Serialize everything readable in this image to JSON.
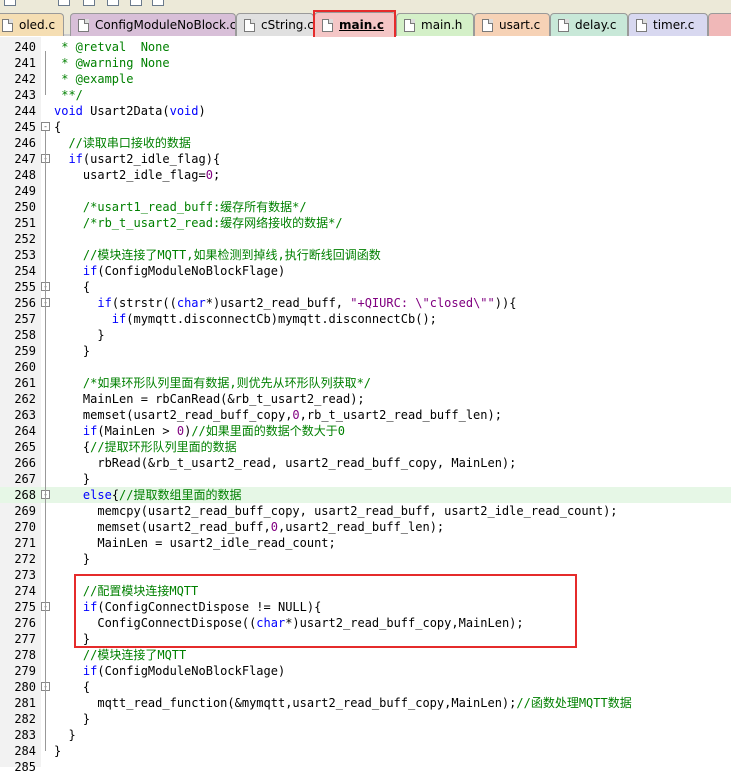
{
  "tabs": [
    {
      "label": "oled.c",
      "color": "#f5deb3",
      "active": false
    },
    {
      "label": "ConfigModuleNoBlock.c",
      "color": "#d8bfd8",
      "active": false
    },
    {
      "label": "cString.c",
      "color": "#e0e0e0",
      "active": false
    },
    {
      "label": "main.c",
      "color": "#f4c6c6",
      "active": true
    },
    {
      "label": "main.h",
      "color": "#d4f0c8",
      "active": false
    },
    {
      "label": "usart.c",
      "color": "#f6d2b6",
      "active": false
    },
    {
      "label": "delay.c",
      "color": "#c8e8d8",
      "active": false
    },
    {
      "label": "timer.c",
      "color": "#d8d8f0",
      "active": false
    }
  ],
  "lines": [
    {
      "n": "240",
      "tokens": [
        {
          "t": " * @retval  None",
          "c": "cm"
        }
      ]
    },
    {
      "n": "241",
      "tokens": [
        {
          "t": " * @warning None",
          "c": "cm"
        }
      ]
    },
    {
      "n": "242",
      "tokens": [
        {
          "t": " * @example",
          "c": "cm"
        }
      ]
    },
    {
      "n": "243",
      "tokens": [
        {
          "t": " **/",
          "c": "cm"
        }
      ]
    },
    {
      "n": "244",
      "tokens": [
        {
          "t": "void",
          "c": "kw"
        },
        {
          "t": " Usart2Data(",
          "c": "fn"
        },
        {
          "t": "void",
          "c": "kw"
        },
        {
          "t": ")",
          "c": "fn"
        }
      ]
    },
    {
      "n": "245",
      "tokens": [
        {
          "t": "{",
          "c": "fn"
        }
      ]
    },
    {
      "n": "246",
      "tokens": [
        {
          "t": "  //读取串口接收的数据",
          "c": "cm"
        }
      ]
    },
    {
      "n": "247",
      "tokens": [
        {
          "t": "  ",
          "c": "fn"
        },
        {
          "t": "if",
          "c": "kw"
        },
        {
          "t": "(usart2_idle_flag){",
          "c": "fn"
        }
      ]
    },
    {
      "n": "248",
      "tokens": [
        {
          "t": "    usart2_idle_flag=",
          "c": "fn"
        },
        {
          "t": "0",
          "c": "num"
        },
        {
          "t": ";",
          "c": "fn"
        }
      ]
    },
    {
      "n": "249",
      "tokens": []
    },
    {
      "n": "250",
      "tokens": [
        {
          "t": "    /*usart1_read_buff:缓存所有数据*/",
          "c": "cm"
        }
      ]
    },
    {
      "n": "251",
      "tokens": [
        {
          "t": "    /*rb_t_usart2_read:缓存网络接收的数据*/",
          "c": "cm"
        }
      ]
    },
    {
      "n": "252",
      "tokens": []
    },
    {
      "n": "253",
      "tokens": [
        {
          "t": "    //模块连接了MQTT,如果检测到掉线,执行断线回调函数",
          "c": "cm"
        }
      ]
    },
    {
      "n": "254",
      "tokens": [
        {
          "t": "    ",
          "c": "fn"
        },
        {
          "t": "if",
          "c": "kw"
        },
        {
          "t": "(ConfigModuleNoBlockFlage)",
          "c": "fn"
        }
      ]
    },
    {
      "n": "255",
      "tokens": [
        {
          "t": "    {",
          "c": "fn"
        }
      ]
    },
    {
      "n": "256",
      "tokens": [
        {
          "t": "      ",
          "c": "fn"
        },
        {
          "t": "if",
          "c": "kw"
        },
        {
          "t": "(strstr((",
          "c": "fn"
        },
        {
          "t": "char",
          "c": "kw"
        },
        {
          "t": "*)usart2_read_buff, ",
          "c": "fn"
        },
        {
          "t": "\"+QIURC: \\\"closed\\\"\"",
          "c": "str"
        },
        {
          "t": ")){",
          "c": "fn"
        }
      ]
    },
    {
      "n": "257",
      "tokens": [
        {
          "t": "        ",
          "c": "fn"
        },
        {
          "t": "if",
          "c": "kw"
        },
        {
          "t": "(mymqtt.disconnectCb)mymqtt.disconnectCb();",
          "c": "fn"
        }
      ]
    },
    {
      "n": "258",
      "tokens": [
        {
          "t": "      }",
          "c": "fn"
        }
      ]
    },
    {
      "n": "259",
      "tokens": [
        {
          "t": "    }",
          "c": "fn"
        }
      ]
    },
    {
      "n": "260",
      "tokens": []
    },
    {
      "n": "261",
      "tokens": [
        {
          "t": "    /*如果环形队列里面有数据,则优先从环形队列获取*/",
          "c": "cm"
        }
      ]
    },
    {
      "n": "262",
      "tokens": [
        {
          "t": "    MainLen = rbCanRead(&rb_t_usart2_read);",
          "c": "fn"
        }
      ]
    },
    {
      "n": "263",
      "tokens": [
        {
          "t": "    memset(usart2_read_buff_copy,",
          "c": "fn"
        },
        {
          "t": "0",
          "c": "num"
        },
        {
          "t": ",rb_t_usart2_read_buff_len);",
          "c": "fn"
        }
      ]
    },
    {
      "n": "264",
      "tokens": [
        {
          "t": "    ",
          "c": "fn"
        },
        {
          "t": "if",
          "c": "kw"
        },
        {
          "t": "(MainLen > ",
          "c": "fn"
        },
        {
          "t": "0",
          "c": "num"
        },
        {
          "t": ")",
          "c": "fn"
        },
        {
          "t": "//如果里面的数据个数大于0",
          "c": "cm"
        }
      ]
    },
    {
      "n": "265",
      "tokens": [
        {
          "t": "    {",
          "c": "fn"
        },
        {
          "t": "//提取环形队列里面的数据",
          "c": "cm"
        }
      ]
    },
    {
      "n": "266",
      "tokens": [
        {
          "t": "      rbRead(&rb_t_usart2_read, usart2_read_buff_copy, MainLen);",
          "c": "fn"
        }
      ]
    },
    {
      "n": "267",
      "tokens": [
        {
          "t": "    }",
          "c": "fn"
        }
      ]
    },
    {
      "n": "268",
      "tokens": [
        {
          "t": "    ",
          "c": "fn"
        },
        {
          "t": "else",
          "c": "kw"
        },
        {
          "t": "{",
          "c": "fn"
        },
        {
          "t": "//提取数组里面的数据",
          "c": "cm"
        }
      ],
      "highlight": true
    },
    {
      "n": "269",
      "tokens": [
        {
          "t": "      memcpy(usart2_read_buff_copy, usart2_read_buff, usart2_idle_read_count);",
          "c": "fn"
        }
      ]
    },
    {
      "n": "270",
      "tokens": [
        {
          "t": "      memset(usart2_read_buff,",
          "c": "fn"
        },
        {
          "t": "0",
          "c": "num"
        },
        {
          "t": ",usart2_read_buff_len);",
          "c": "fn"
        }
      ]
    },
    {
      "n": "271",
      "tokens": [
        {
          "t": "      MainLen = usart2_idle_read_count;",
          "c": "fn"
        }
      ]
    },
    {
      "n": "272",
      "tokens": [
        {
          "t": "    }",
          "c": "fn"
        }
      ]
    },
    {
      "n": "273",
      "tokens": []
    },
    {
      "n": "274",
      "tokens": [
        {
          "t": "    //配置模块连接MQTT",
          "c": "cm"
        }
      ]
    },
    {
      "n": "275",
      "tokens": [
        {
          "t": "    ",
          "c": "fn"
        },
        {
          "t": "if",
          "c": "kw"
        },
        {
          "t": "(ConfigConnectDispose != NULL){",
          "c": "fn"
        }
      ]
    },
    {
      "n": "276",
      "tokens": [
        {
          "t": "      ConfigConnectDispose((",
          "c": "fn"
        },
        {
          "t": "char",
          "c": "kw"
        },
        {
          "t": "*)usart2_read_buff_copy,MainLen);",
          "c": "fn"
        }
      ]
    },
    {
      "n": "277",
      "tokens": [
        {
          "t": "    }",
          "c": "fn"
        }
      ]
    },
    {
      "n": "278",
      "tokens": [
        {
          "t": "    //模块连接了MQTT",
          "c": "cm"
        }
      ]
    },
    {
      "n": "279",
      "tokens": [
        {
          "t": "    ",
          "c": "fn"
        },
        {
          "t": "if",
          "c": "kw"
        },
        {
          "t": "(ConfigModuleNoBlockFlage)",
          "c": "fn"
        }
      ]
    },
    {
      "n": "280",
      "tokens": [
        {
          "t": "    {",
          "c": "fn"
        }
      ]
    },
    {
      "n": "281",
      "tokens": [
        {
          "t": "      mqtt_read_function(&mymqtt,usart2_read_buff_copy,MainLen);",
          "c": "fn"
        },
        {
          "t": "//函数处理MQTT数据",
          "c": "cm"
        }
      ]
    },
    {
      "n": "282",
      "tokens": [
        {
          "t": "    }",
          "c": "fn"
        }
      ]
    },
    {
      "n": "283",
      "tokens": [
        {
          "t": "  }",
          "c": "fn"
        }
      ]
    },
    {
      "n": "284",
      "tokens": [
        {
          "t": "}",
          "c": "fn"
        }
      ]
    },
    {
      "n": "285",
      "tokens": []
    }
  ],
  "fold_markers": {
    "245": "-",
    "247": "-",
    "255": "-",
    "256": "-",
    "268": "-",
    "275": "-",
    "280": "-"
  },
  "colors": {
    "highlight_box": "#e52b2b",
    "keyword": "#0000ff",
    "comment": "#008000",
    "number": "#800080",
    "current_line": "#e6f7e6"
  }
}
